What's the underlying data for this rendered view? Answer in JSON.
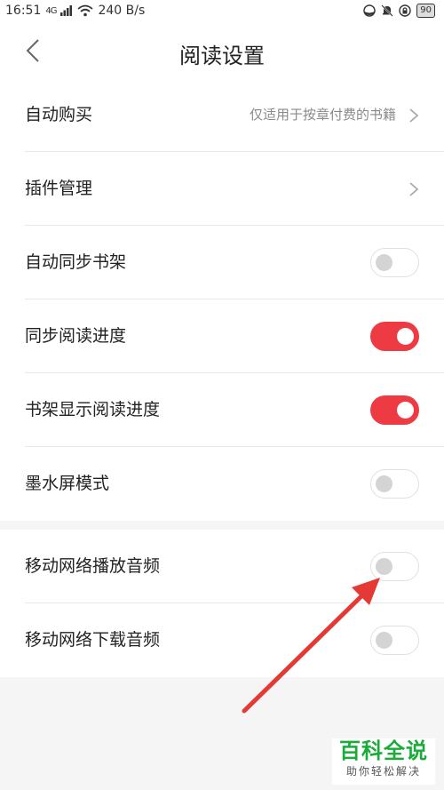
{
  "status_bar": {
    "time": "16:51",
    "signal": "4G",
    "speed": "240 B/s",
    "battery": "90"
  },
  "header": {
    "title": "阅读设置"
  },
  "settings_group_1": [
    {
      "label": "自动购买",
      "detail": "仅适用于按章付费的书籍",
      "control": "chevron"
    },
    {
      "label": "插件管理",
      "detail": "",
      "control": "chevron"
    },
    {
      "label": "自动同步书架",
      "control": "toggle",
      "on": false
    },
    {
      "label": "同步阅读进度",
      "control": "toggle",
      "on": true
    },
    {
      "label": "书架显示阅读进度",
      "control": "toggle",
      "on": true
    },
    {
      "label": "墨水屏模式",
      "control": "toggle",
      "on": false
    }
  ],
  "settings_group_2": [
    {
      "label": "移动网络播放音频",
      "control": "toggle",
      "on": false
    },
    {
      "label": "移动网络下载音频",
      "control": "toggle",
      "on": false
    }
  ],
  "watermark": {
    "title": "百科全说",
    "subtitle": "助你轻松解决"
  },
  "colors": {
    "accent": "#ee3a43",
    "toggle_off_knob": "#d4d4d4",
    "background": "#f5f5f5",
    "watermark_green": "#1aab3a"
  }
}
